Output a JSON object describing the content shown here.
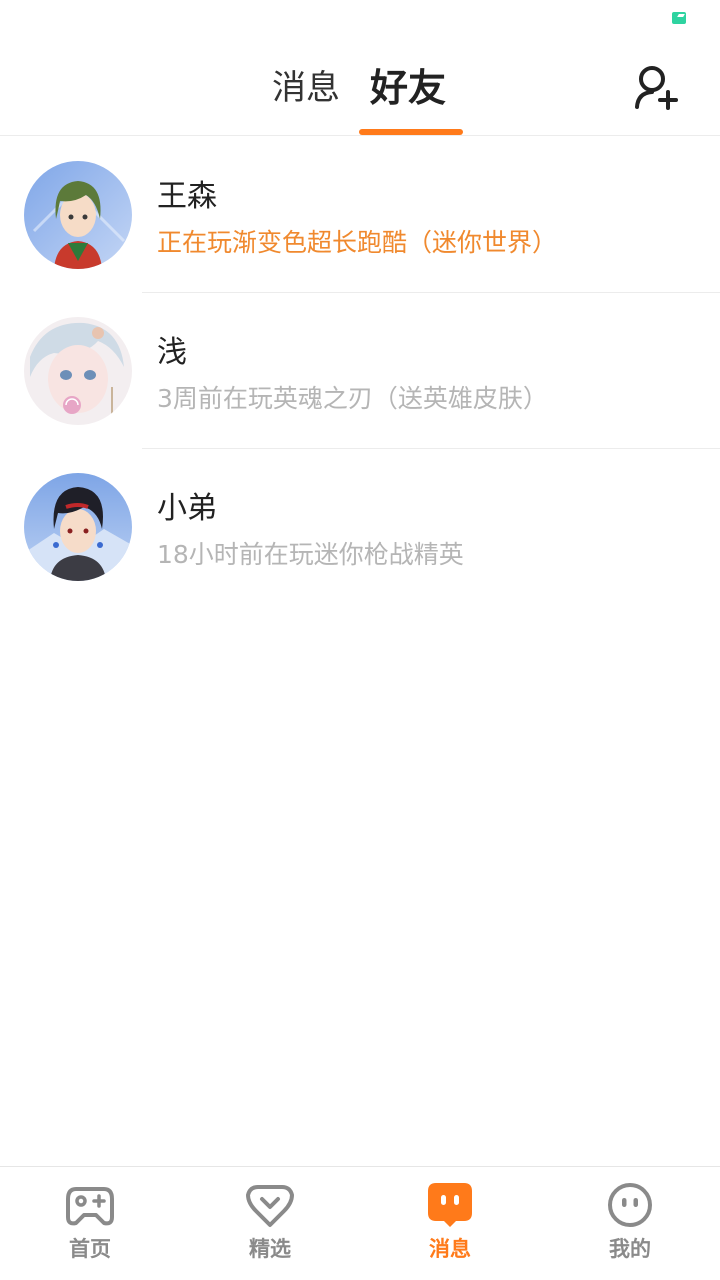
{
  "colors": {
    "accent": "#ff7a1a",
    "online_status": "#f0892e",
    "offline_status": "#b5b5b5",
    "battery": "#2ed3a0"
  },
  "header": {
    "tabs": [
      {
        "label": "消息",
        "active": false
      },
      {
        "label": "好友",
        "active": true
      }
    ],
    "add_friend_icon": "add-person-icon"
  },
  "friends": [
    {
      "name": "王森",
      "status": "正在玩渐变色超长跑酷（迷你世界）",
      "online": true
    },
    {
      "name": "浅",
      "status": "3周前在玩英魂之刃（送英雄皮肤）",
      "online": false
    },
    {
      "name": "小弟",
      "status": "18小时前在玩迷你枪战精英",
      "online": false
    }
  ],
  "bottom_nav": [
    {
      "label": "首页",
      "icon": "gamepad-icon",
      "active": false
    },
    {
      "label": "精选",
      "icon": "heart-icon",
      "active": false
    },
    {
      "label": "消息",
      "icon": "chat-bubble-icon",
      "active": true
    },
    {
      "label": "我的",
      "icon": "face-icon",
      "active": false
    }
  ]
}
